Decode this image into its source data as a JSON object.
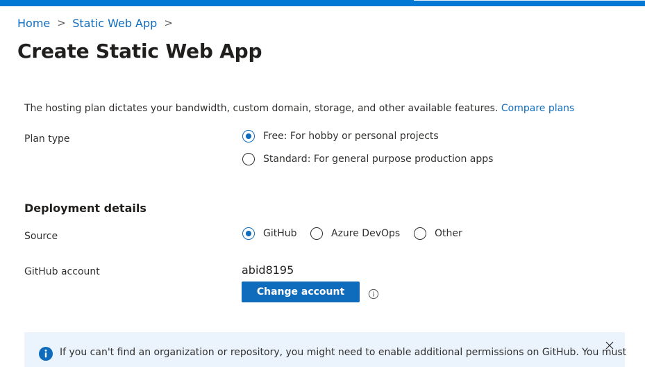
{
  "breadcrumb": {
    "items": [
      {
        "label": "Home"
      },
      {
        "label": "Static Web App"
      }
    ],
    "separator": ">"
  },
  "page": {
    "title": "Create Static Web App",
    "more_label": "···"
  },
  "hosting": {
    "description": "The hosting plan dictates your bandwidth, custom domain, storage, and other available features.",
    "compare_link": "Compare plans"
  },
  "plan": {
    "label": "Plan type",
    "options": [
      {
        "label": "Free: For hobby or personal projects",
        "selected": true
      },
      {
        "label": "Standard: For general purpose production apps",
        "selected": false
      }
    ]
  },
  "deployment": {
    "heading": "Deployment details",
    "source_label": "Source",
    "sources": [
      {
        "label": "GitHub",
        "selected": true
      },
      {
        "label": "Azure DevOps",
        "selected": false
      },
      {
        "label": "Other",
        "selected": false
      }
    ],
    "account_label": "GitHub account",
    "account_value": "abid8195",
    "change_account_button": "Change account"
  },
  "notice": {
    "text": "If you can't find an organization or repository, you might need to enable additional permissions on GitHub. You must"
  },
  "colors": {
    "accent": "#0f6cbd",
    "topbar": "#0078d4",
    "notice_bg": "#ebf3fc",
    "text": "#323130"
  },
  "icons": {
    "more": "ellipsis-icon",
    "info": "info-icon",
    "notice": "info-filled-icon",
    "close": "close-icon",
    "separator": "chevron-right-icon"
  }
}
